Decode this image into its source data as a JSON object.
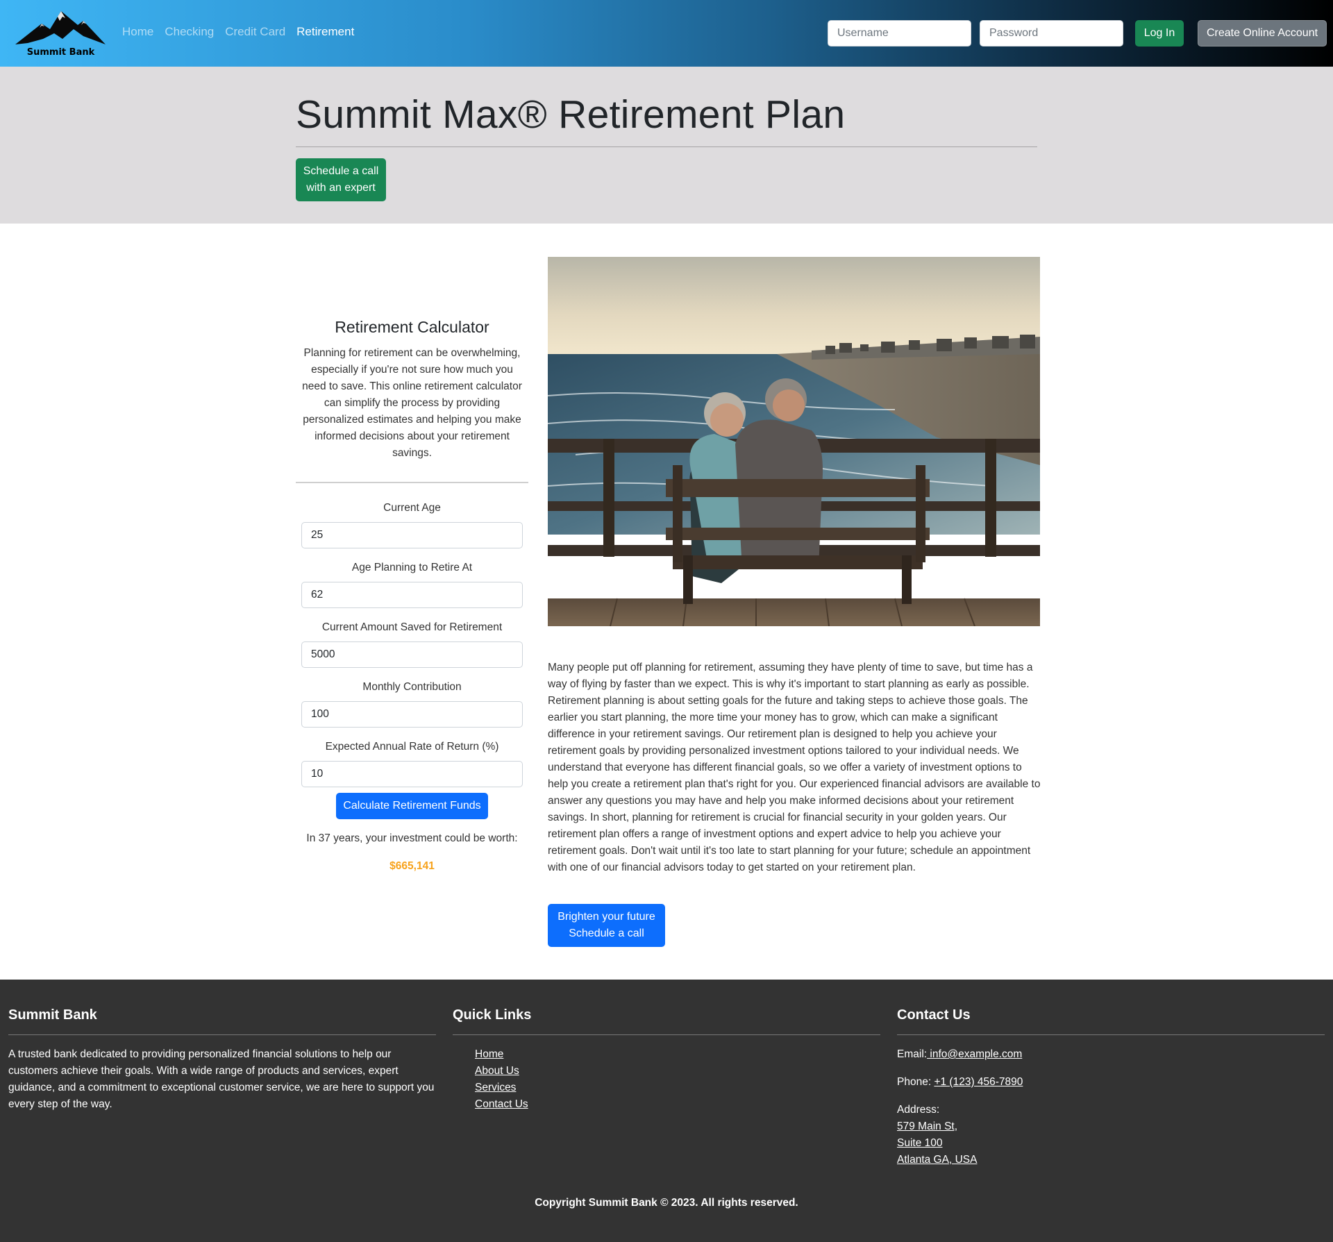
{
  "nav": {
    "brand": "Summit Bank",
    "links": [
      {
        "label": "Home"
      },
      {
        "label": "Checking"
      },
      {
        "label": "Credit Card"
      },
      {
        "label": "Retirement"
      }
    ],
    "username_placeholder": "Username",
    "password_placeholder": "Password",
    "login_label": "Log In",
    "create_account_label": "Create Online Account"
  },
  "hero": {
    "title": "Summit Max® Retirement Plan",
    "cta_line1": "Schedule a call",
    "cta_line2": "with an expert"
  },
  "calculator": {
    "title": "Retirement Calculator",
    "description": "Planning for retirement can be overwhelming, especially if you're not sure how much you need to save. This online retirement calculator can simplify the process by providing personalized estimates and helping you make informed decisions about your retirement savings.",
    "fields": [
      {
        "label": "Current Age",
        "value": "25"
      },
      {
        "label": "Age Planning to Retire At",
        "value": "62"
      },
      {
        "label": "Current Amount Saved for Retirement",
        "value": "5000"
      },
      {
        "label": "Monthly Contribution",
        "value": "100"
      },
      {
        "label": "Expected Annual Rate of Return (%)",
        "value": "10"
      }
    ],
    "button_label": "Calculate Retirement Funds",
    "result_text": "In 37 years, your investment could be worth:",
    "result_value": "$665,141"
  },
  "main": {
    "body_text": "Many people put off planning for retirement, assuming they have plenty of time to save, but time has a way of flying by faster than we expect. This is why it's important to start planning as early as possible. Retirement planning is about setting goals for the future and taking steps to achieve those goals. The earlier you start planning, the more time your money has to grow, which can make a significant difference in your retirement savings. Our retirement plan is designed to help you achieve your retirement goals by providing personalized investment options tailored to your individual needs. We understand that everyone has different financial goals, so we offer a variety of investment options to help you create a retirement plan that's right for you. Our experienced financial advisors are available to answer any questions you may have and help you make informed decisions about your retirement savings. In short, planning for retirement is crucial for financial security in your golden years. Our retirement plan offers a range of investment options and expert advice to help you achieve your retirement goals. Don't wait until it's too late to start planning for your future; schedule an appointment with one of our financial advisors today to get started on your retirement plan.",
    "cta_line1": "Brighten your future",
    "cta_line2": "Schedule a call"
  },
  "footer": {
    "about_heading": "Summit Bank",
    "about_text": "A trusted bank dedicated to providing personalized financial solutions to help our customers achieve their goals. With a wide range of products and services, expert guidance, and a commitment to exceptional customer service, we are here to support you every step of the way.",
    "links_heading": "Quick Links",
    "links": [
      {
        "label": "Home"
      },
      {
        "label": "About Us"
      },
      {
        "label": "Services"
      },
      {
        "label": "Contact Us"
      }
    ],
    "contact_heading": "Contact Us",
    "email_label": "Email:",
    "email": " info@example.com",
    "phone_label": "Phone: ",
    "phone": "+1 (123) 456-7890",
    "address_label": "Address:",
    "address_lines": [
      "579 Main St,",
      "Suite 100",
      "Atlanta GA, USA"
    ],
    "copyright": "Copyright Summit Bank © 2023. All rights reserved."
  },
  "colors": {
    "success": "#198754",
    "primary": "#0d6efd",
    "secondary": "#6c757d",
    "result": "#f7a21b",
    "footer_bg": "#333333",
    "hero_bg": "#dedcde"
  }
}
